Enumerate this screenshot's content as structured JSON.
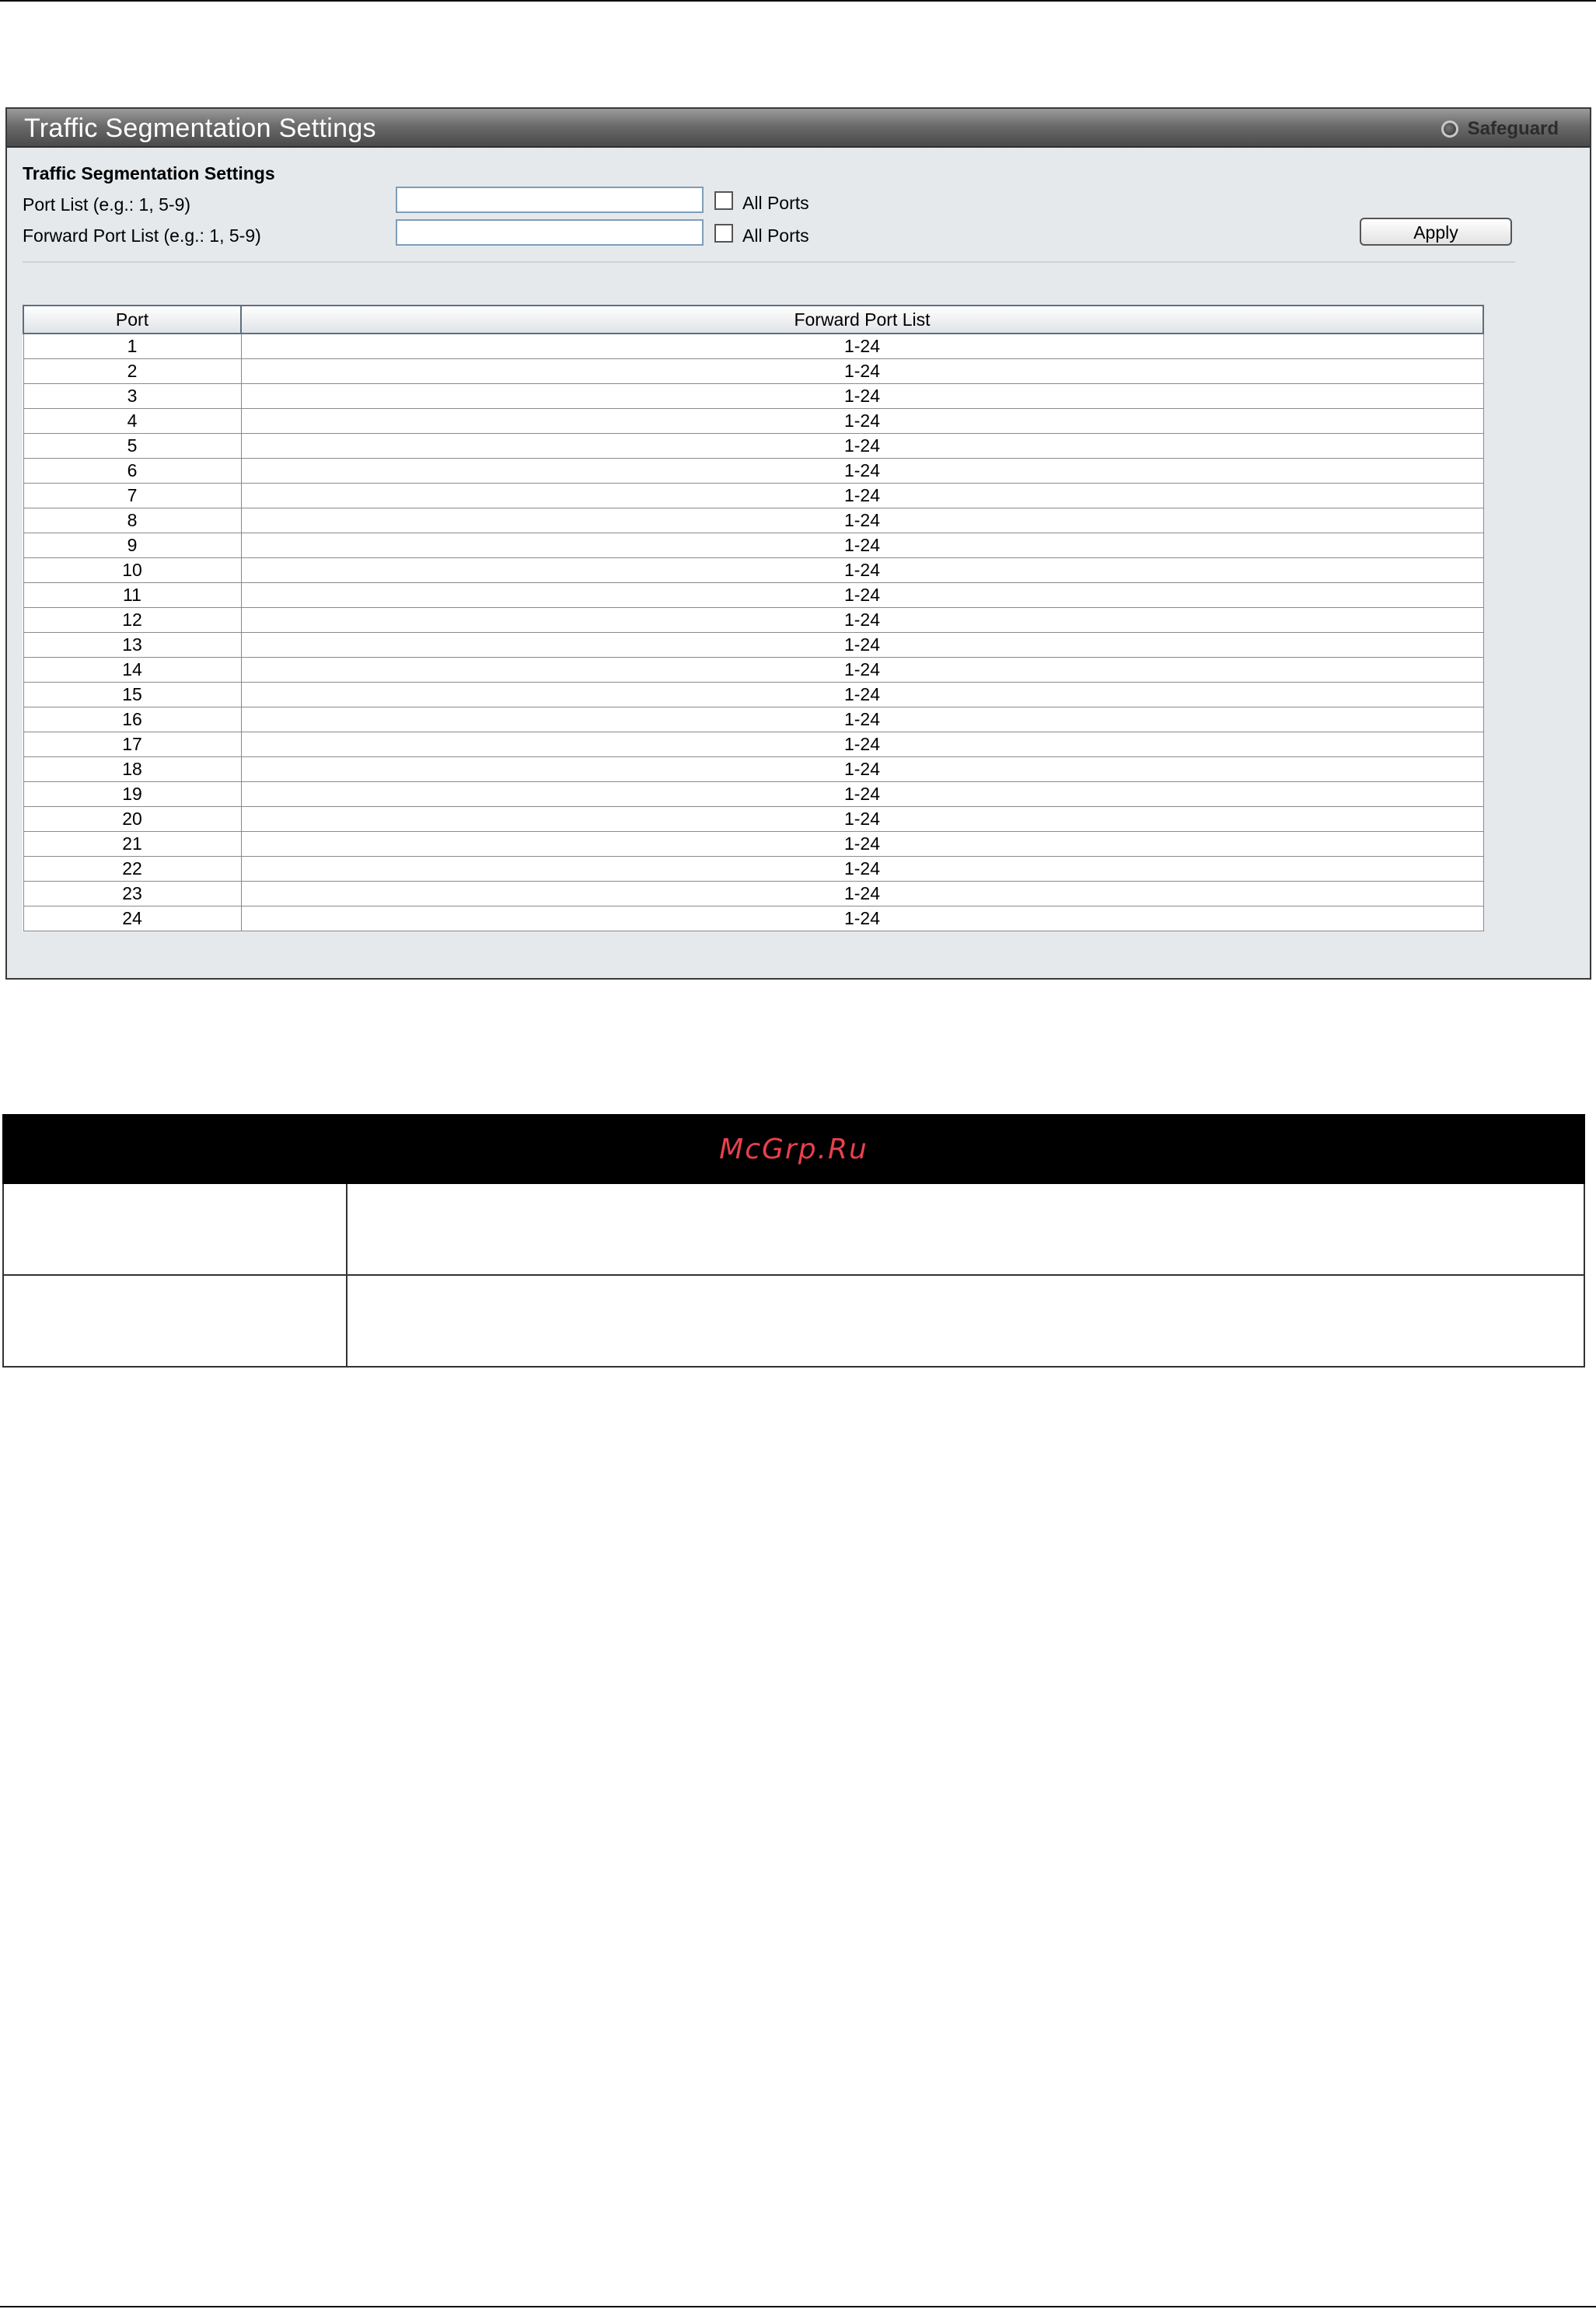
{
  "panel": {
    "title": "Traffic Segmentation Settings",
    "safeguard_label": "Safeguard"
  },
  "form": {
    "section_title": "Traffic Segmentation Settings",
    "port_list_label": "Port List (e.g.: 1, 5-9)",
    "port_list_value": "",
    "forward_port_list_label": "Forward Port List (e.g.: 1, 5-9)",
    "forward_port_list_value": "",
    "all_ports_label": "All Ports",
    "all_ports_checked": false,
    "forward_all_ports_checked": false,
    "apply_label": "Apply"
  },
  "table": {
    "headers": [
      "Port",
      "Forward Port List"
    ],
    "rows": [
      [
        "1",
        "1-24"
      ],
      [
        "2",
        "1-24"
      ],
      [
        "3",
        "1-24"
      ],
      [
        "4",
        "1-24"
      ],
      [
        "5",
        "1-24"
      ],
      [
        "6",
        "1-24"
      ],
      [
        "7",
        "1-24"
      ],
      [
        "8",
        "1-24"
      ],
      [
        "9",
        "1-24"
      ],
      [
        "10",
        "1-24"
      ],
      [
        "11",
        "1-24"
      ],
      [
        "12",
        "1-24"
      ],
      [
        "13",
        "1-24"
      ],
      [
        "14",
        "1-24"
      ],
      [
        "15",
        "1-24"
      ],
      [
        "16",
        "1-24"
      ],
      [
        "17",
        "1-24"
      ],
      [
        "18",
        "1-24"
      ],
      [
        "19",
        "1-24"
      ],
      [
        "20",
        "1-24"
      ],
      [
        "21",
        "1-24"
      ],
      [
        "22",
        "1-24"
      ],
      [
        "23",
        "1-24"
      ],
      [
        "24",
        "1-24"
      ]
    ]
  },
  "description_table": {
    "watermark": "McGrp.Ru",
    "rows": [
      [
        "",
        ""
      ],
      [
        "",
        ""
      ]
    ]
  },
  "colors": {
    "header_dark": "#4a4a4a",
    "panel_bg": "#e6e9ec",
    "watermark": "#e8404c"
  }
}
